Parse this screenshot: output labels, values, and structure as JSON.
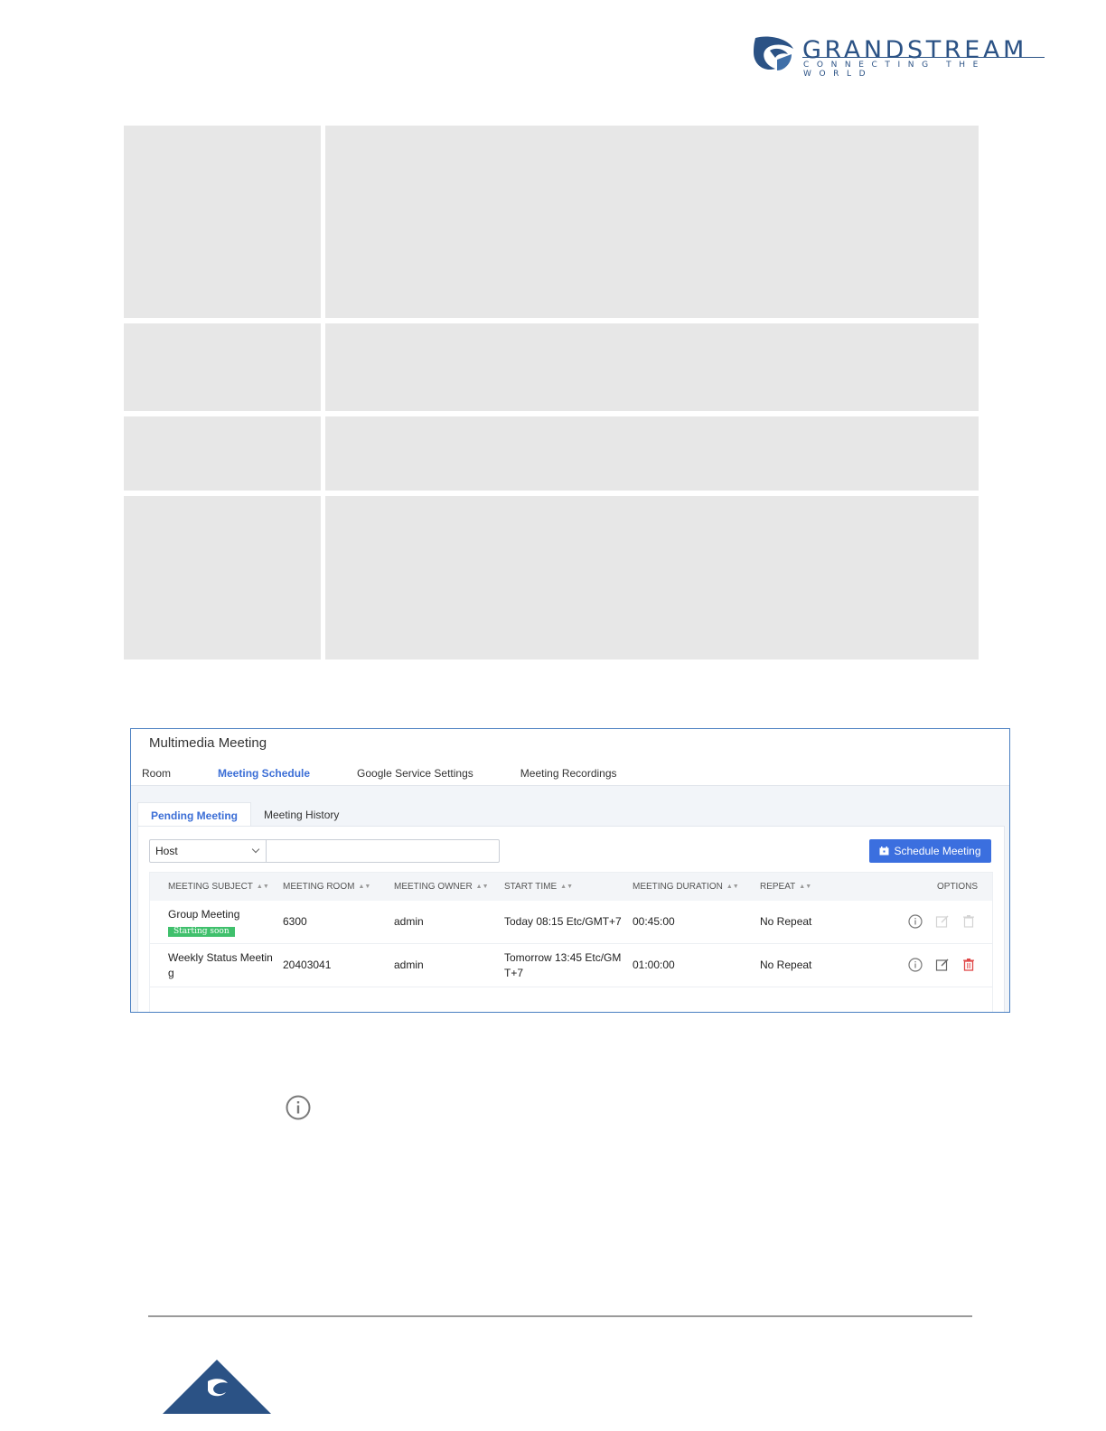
{
  "brand": {
    "name": "GRANDSTREAM",
    "tagline": "CONNECTING THE WORLD"
  },
  "colors": {
    "brand_blue": "#2b5285",
    "accent_blue": "#3b6ed6",
    "badge_green": "#3fc06c",
    "delete_red": "#e04848",
    "table_gray": "#e7e7e7"
  },
  "screenshot": {
    "title": "Multimedia Meeting",
    "tabs": [
      {
        "label": "Room",
        "active": false
      },
      {
        "label": "Meeting Schedule",
        "active": true
      },
      {
        "label": "Google Service Settings",
        "active": false
      },
      {
        "label": "Meeting Recordings",
        "active": false
      }
    ],
    "sub_tabs": [
      {
        "label": "Pending Meeting",
        "active": true
      },
      {
        "label": "Meeting History",
        "active": false
      }
    ],
    "filter": {
      "select_value": "Host",
      "input_value": ""
    },
    "schedule_button": "Schedule Meeting",
    "columns": [
      "MEETING SUBJECT",
      "MEETING ROOM",
      "MEETING OWNER",
      "START TIME",
      "MEETING DURATION",
      "REPEAT",
      "OPTIONS"
    ],
    "rows": [
      {
        "subject": "Group Meeting",
        "badge": "Starting soon",
        "room": "6300",
        "owner": "admin",
        "start_line1": "Today 08:15 Etc/GMT+7",
        "start_line2": "",
        "duration": "00:45:00",
        "repeat": "No Repeat",
        "options": [
          "info-icon",
          "edit-icon-disabled",
          "delete-icon-disabled"
        ]
      },
      {
        "subject_line1": "Weekly Status Meetin",
        "subject_line2": "g",
        "room": "20403041",
        "owner": "admin",
        "start_line1": "Tomorrow 13:45 Etc/GM",
        "start_line2": "T+7",
        "duration": "01:00:00",
        "repeat": "No Repeat",
        "options": [
          "info-icon",
          "edit-icon",
          "delete-icon"
        ]
      }
    ]
  }
}
